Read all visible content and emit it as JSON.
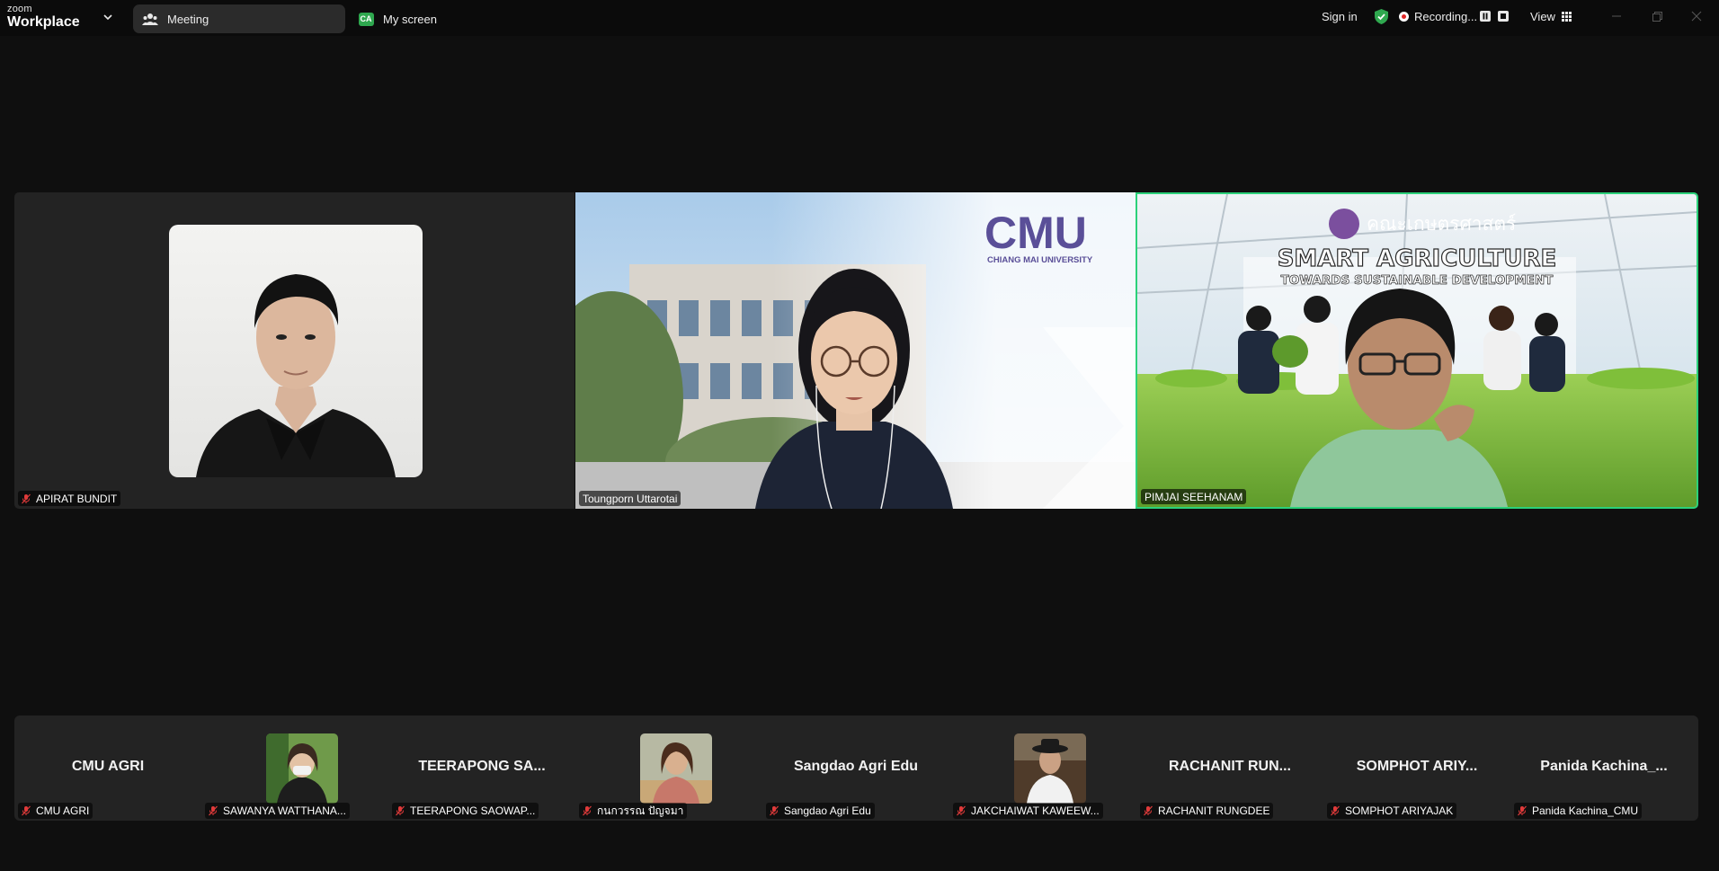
{
  "app": {
    "brand_small": "zoom",
    "brand_large": "Workplace"
  },
  "tabs": [
    {
      "label": "Meeting",
      "active": true
    },
    {
      "label": "My screen",
      "badge": "CA"
    }
  ],
  "topbar": {
    "sign_in": "Sign in",
    "recording": "Recording...",
    "view": "View"
  },
  "speakers": [
    {
      "name": "APIRAT BUNDIT",
      "muted": true
    },
    {
      "name": "Toungporn Uttarotai",
      "muted": false,
      "logo_text": "CMU",
      "logo_sub": "CHIANG MAI UNIVERSITY"
    },
    {
      "name": "PIMJAI SEEHANAM",
      "muted": false,
      "active_speaker": true,
      "banner_title": "SMART AGRICULTURE",
      "banner_sub": "TOWARDS SUSTAINABLE DEVELOPMENT",
      "faculty_text": "คณะเกษตรศาสตร์"
    }
  ],
  "gallery": [
    {
      "display": "CMU AGRI",
      "label": "CMU AGRI",
      "has_video": false
    },
    {
      "display": "",
      "label": "SAWANYA WATTHANA...",
      "has_video": true
    },
    {
      "display": "TEERAPONG SA...",
      "label": "TEERAPONG SAOWAP...",
      "has_video": false
    },
    {
      "display": "",
      "label": "กนกวรรณ ปัญจมา",
      "has_video": true
    },
    {
      "display": "Sangdao Agri Edu",
      "label": "Sangdao Agri Edu",
      "has_video": false
    },
    {
      "display": "",
      "label": "JAKCHAIWAT KAWEEW...",
      "has_video": true
    },
    {
      "display": "RACHANIT RUN...",
      "label": "RACHANIT RUNGDEE",
      "has_video": false
    },
    {
      "display": "SOMPHOT ARIY...",
      "label": "SOMPHOT ARIYAJAK",
      "has_video": false
    },
    {
      "display": "Panida Kachina_...",
      "label": "Panida Kachina_CMU",
      "has_video": false
    }
  ],
  "colors": {
    "active_speaker_border": "#2bd17a",
    "recording_dot": "#e02828",
    "muted_mic": "#e03a3a",
    "secure_shield": "#2fa84f"
  }
}
